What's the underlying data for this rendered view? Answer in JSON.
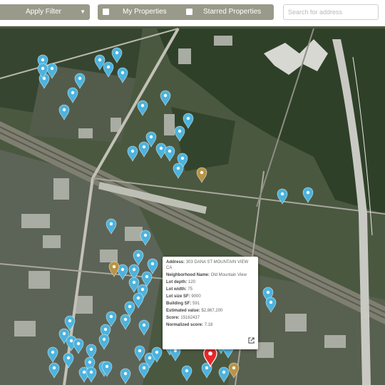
{
  "toolbar": {
    "apply_filter_label": "Apply Filter",
    "my_properties_label": "My Properties",
    "starred_properties_label": "Starred Properties",
    "search_placeholder": "Search for address"
  },
  "map": {
    "selected_property_popup": {
      "address_label": "Address:",
      "address_value": "303 DANA ST MOUNTAIN VIEW CA",
      "neighborhood_label": "Neighborhood Name:",
      "neighborhood_value": "Old Mountain View",
      "lot_depth_label": "Lot depth:",
      "lot_depth_value": "120",
      "lot_width_label": "Lot width:",
      "lot_width_value": "75",
      "lot_size_label": "Lot size SF:",
      "lot_size_value": "9000",
      "building_sf_label": "Building SF:",
      "building_sf_value": "591",
      "estimated_value_label": "Estimated value:",
      "estimated_value_value": "$2,867,200",
      "score_label": "Score:",
      "score_value": "15162437",
      "normalized_score_label": "Normalized score:",
      "normalized_score_value": "7.18",
      "open_icon": "external-link-icon"
    },
    "marker_colors": {
      "default": "#4cb3dd",
      "starred": "#b89446",
      "selected": "#e8272b"
    },
    "markers": [
      {
        "kind": "default"
      },
      {
        "kind": "default"
      },
      {
        "kind": "default"
      },
      {
        "kind": "default"
      },
      {
        "kind": "default"
      },
      {
        "kind": "default"
      },
      {
        "kind": "default"
      },
      {
        "kind": "default"
      },
      {
        "kind": "default"
      },
      {
        "kind": "default"
      },
      {
        "kind": "default"
      },
      {
        "kind": "default"
      },
      {
        "kind": "default"
      },
      {
        "kind": "default"
      },
      {
        "kind": "default"
      },
      {
        "kind": "default"
      },
      {
        "kind": "default"
      },
      {
        "kind": "default"
      },
      {
        "kind": "default"
      },
      {
        "kind": "default"
      },
      {
        "kind": "default"
      },
      {
        "kind": "default"
      },
      {
        "kind": "default"
      },
      {
        "kind": "default"
      },
      {
        "kind": "default"
      },
      {
        "kind": "default"
      },
      {
        "kind": "default"
      },
      {
        "kind": "default"
      },
      {
        "kind": "default"
      },
      {
        "kind": "default"
      },
      {
        "kind": "default"
      },
      {
        "kind": "default"
      },
      {
        "kind": "default"
      },
      {
        "kind": "default"
      },
      {
        "kind": "default"
      },
      {
        "kind": "default"
      },
      {
        "kind": "default"
      },
      {
        "kind": "default"
      },
      {
        "kind": "default"
      },
      {
        "kind": "default"
      },
      {
        "kind": "default"
      },
      {
        "kind": "default"
      },
      {
        "kind": "default"
      },
      {
        "kind": "default"
      },
      {
        "kind": "default"
      },
      {
        "kind": "default"
      },
      {
        "kind": "default"
      },
      {
        "kind": "default"
      },
      {
        "kind": "default"
      },
      {
        "kind": "default"
      },
      {
        "kind": "default"
      },
      {
        "kind": "default"
      },
      {
        "kind": "default"
      },
      {
        "kind": "default"
      },
      {
        "kind": "default"
      },
      {
        "kind": "default"
      },
      {
        "kind": "default"
      },
      {
        "kind": "default"
      },
      {
        "kind": "default"
      },
      {
        "kind": "default"
      },
      {
        "kind": "default"
      },
      {
        "kind": "default"
      },
      {
        "kind": "default"
      },
      {
        "kind": "default"
      },
      {
        "kind": "default"
      },
      {
        "kind": "default"
      },
      {
        "kind": "default"
      },
      {
        "kind": "starred"
      },
      {
        "kind": "starred"
      },
      {
        "kind": "starred"
      },
      {
        "kind": "selected"
      }
    ]
  }
}
